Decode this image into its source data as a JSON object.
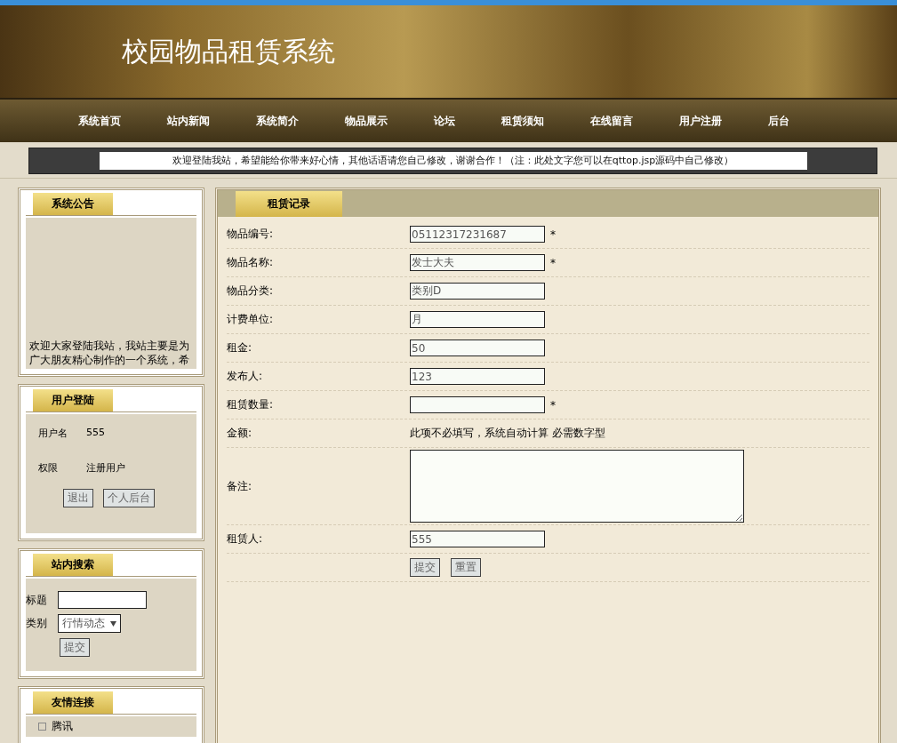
{
  "header": {
    "title": "校园物品租赁系统"
  },
  "nav": [
    {
      "label": "系统首页"
    },
    {
      "label": "站内新闻"
    },
    {
      "label": "系统简介"
    },
    {
      "label": "物品展示"
    },
    {
      "label": "论坛"
    },
    {
      "label": "租赁须知"
    },
    {
      "label": "在线留言"
    },
    {
      "label": "用户注册"
    },
    {
      "label": "后台"
    }
  ],
  "marquee": "欢迎登陆我站，希望能给你带来好心情，其他话语请您自己修改，谢谢合作！（注：此处文字您可以在qttop.jsp源码中自己修改）",
  "sidebar": {
    "announcement": {
      "title": "系统公告",
      "text": "欢迎大家登陆我站，我站主要是为广大朋友精心制作的一个系统，希"
    },
    "login": {
      "title": "用户登陆",
      "rows": [
        {
          "label": "用户名",
          "value": "555"
        },
        {
          "label": "权限",
          "value": "注册用户"
        }
      ],
      "buttons": [
        "退出",
        "个人后台"
      ]
    },
    "search": {
      "title": "站内搜索",
      "title_label": "标题",
      "category_label": "类别",
      "category_value": "行情动态",
      "button": "提交"
    },
    "links": {
      "title": "友情连接",
      "items": [
        "腾讯"
      ]
    }
  },
  "form": {
    "title": "租赁记录",
    "rows": [
      {
        "kind": "input",
        "label": "物品编号:",
        "value": "05112317231687",
        "required": true
      },
      {
        "kind": "input",
        "label": "物品名称:",
        "value": "发士大夫",
        "required": true
      },
      {
        "kind": "input",
        "label": "物品分类:",
        "value": "类别D",
        "required": false
      },
      {
        "kind": "input",
        "label": "计费单位:",
        "value": "月",
        "required": false
      },
      {
        "kind": "input",
        "label": "租金:",
        "value": "50",
        "required": false
      },
      {
        "kind": "input",
        "label": "发布人:",
        "value": "123",
        "required": false
      },
      {
        "kind": "input",
        "label": "租赁数量:",
        "value": "",
        "required": true
      },
      {
        "kind": "note",
        "label": "金额:",
        "value": "此项不必填写，系统自动计算 必需数字型"
      },
      {
        "kind": "textarea",
        "label": "备注:",
        "value": ""
      },
      {
        "kind": "input",
        "label": "租赁人:",
        "value": "555",
        "required": false
      }
    ],
    "buttons": [
      "提交",
      "重置"
    ],
    "required_mark": "*"
  }
}
